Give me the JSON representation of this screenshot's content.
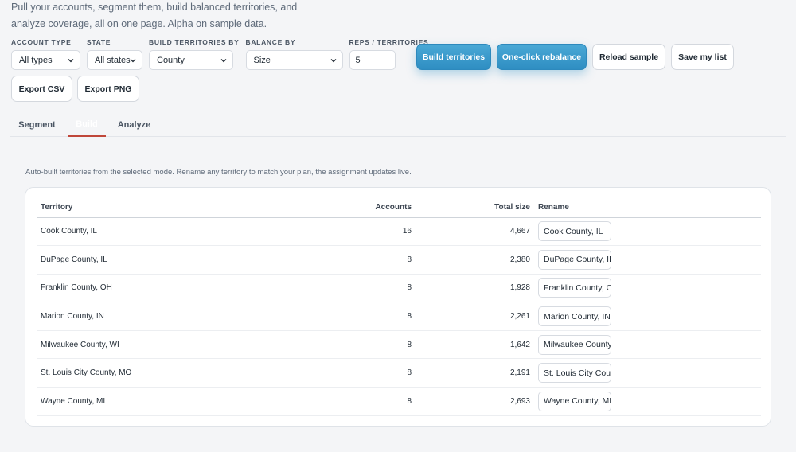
{
  "intro": {
    "text": "Pull your accounts, segment them, build balanced territories, and analyze coverage, all on one page. Alpha on sample data."
  },
  "controls": {
    "account_type": {
      "label": "ACCOUNT TYPE",
      "value": "All types"
    },
    "state": {
      "label": "STATE",
      "value": "All states"
    },
    "build_by": {
      "label": "BUILD TERRITORIES BY",
      "value": "County"
    },
    "balance_by": {
      "label": "BALANCE BY",
      "value": "Size"
    },
    "reps": {
      "label": "REPS / TERRITORIES",
      "value": "5"
    }
  },
  "buttons": {
    "build": "Build territories",
    "rebalance": "One-click rebalance",
    "reload": "Reload sample",
    "save": "Save my list",
    "export_csv": "Export CSV",
    "export_png": "Export PNG"
  },
  "tabs": {
    "segment": "Segment",
    "build": "Build",
    "analyze": "Analyze"
  },
  "build_panel": {
    "description": "Auto-built territories from the selected mode. Rename any territory to match your plan, the assignment updates live.",
    "columns": {
      "territory": "Territory",
      "accounts": "Accounts",
      "total_size": "Total size",
      "rename": "Rename"
    },
    "rows": [
      {
        "territory": "Cook County, IL",
        "accounts": "16",
        "total_size": "4,667",
        "rename": "Cook County, IL"
      },
      {
        "territory": "DuPage County, IL",
        "accounts": "8",
        "total_size": "2,380",
        "rename": "DuPage County, IL"
      },
      {
        "territory": "Franklin County, OH",
        "accounts": "8",
        "total_size": "1,928",
        "rename": "Franklin County, OH"
      },
      {
        "territory": "Marion County, IN",
        "accounts": "8",
        "total_size": "2,261",
        "rename": "Marion County, IN"
      },
      {
        "territory": "Milwaukee County, WI",
        "accounts": "8",
        "total_size": "1,642",
        "rename": "Milwaukee County, WI"
      },
      {
        "territory": "St. Louis City County, MO",
        "accounts": "8",
        "total_size": "2,191",
        "rename": "St. Louis City County, MO"
      },
      {
        "territory": "Wayne County, MI",
        "accounts": "8",
        "total_size": "2,693",
        "rename": "Wayne County, MI"
      }
    ]
  },
  "colors": {
    "accent": "#3399cc",
    "active_tab_underline": "#c0473a"
  },
  "icons": {
    "select_chevron": "chevron-down-icon"
  }
}
